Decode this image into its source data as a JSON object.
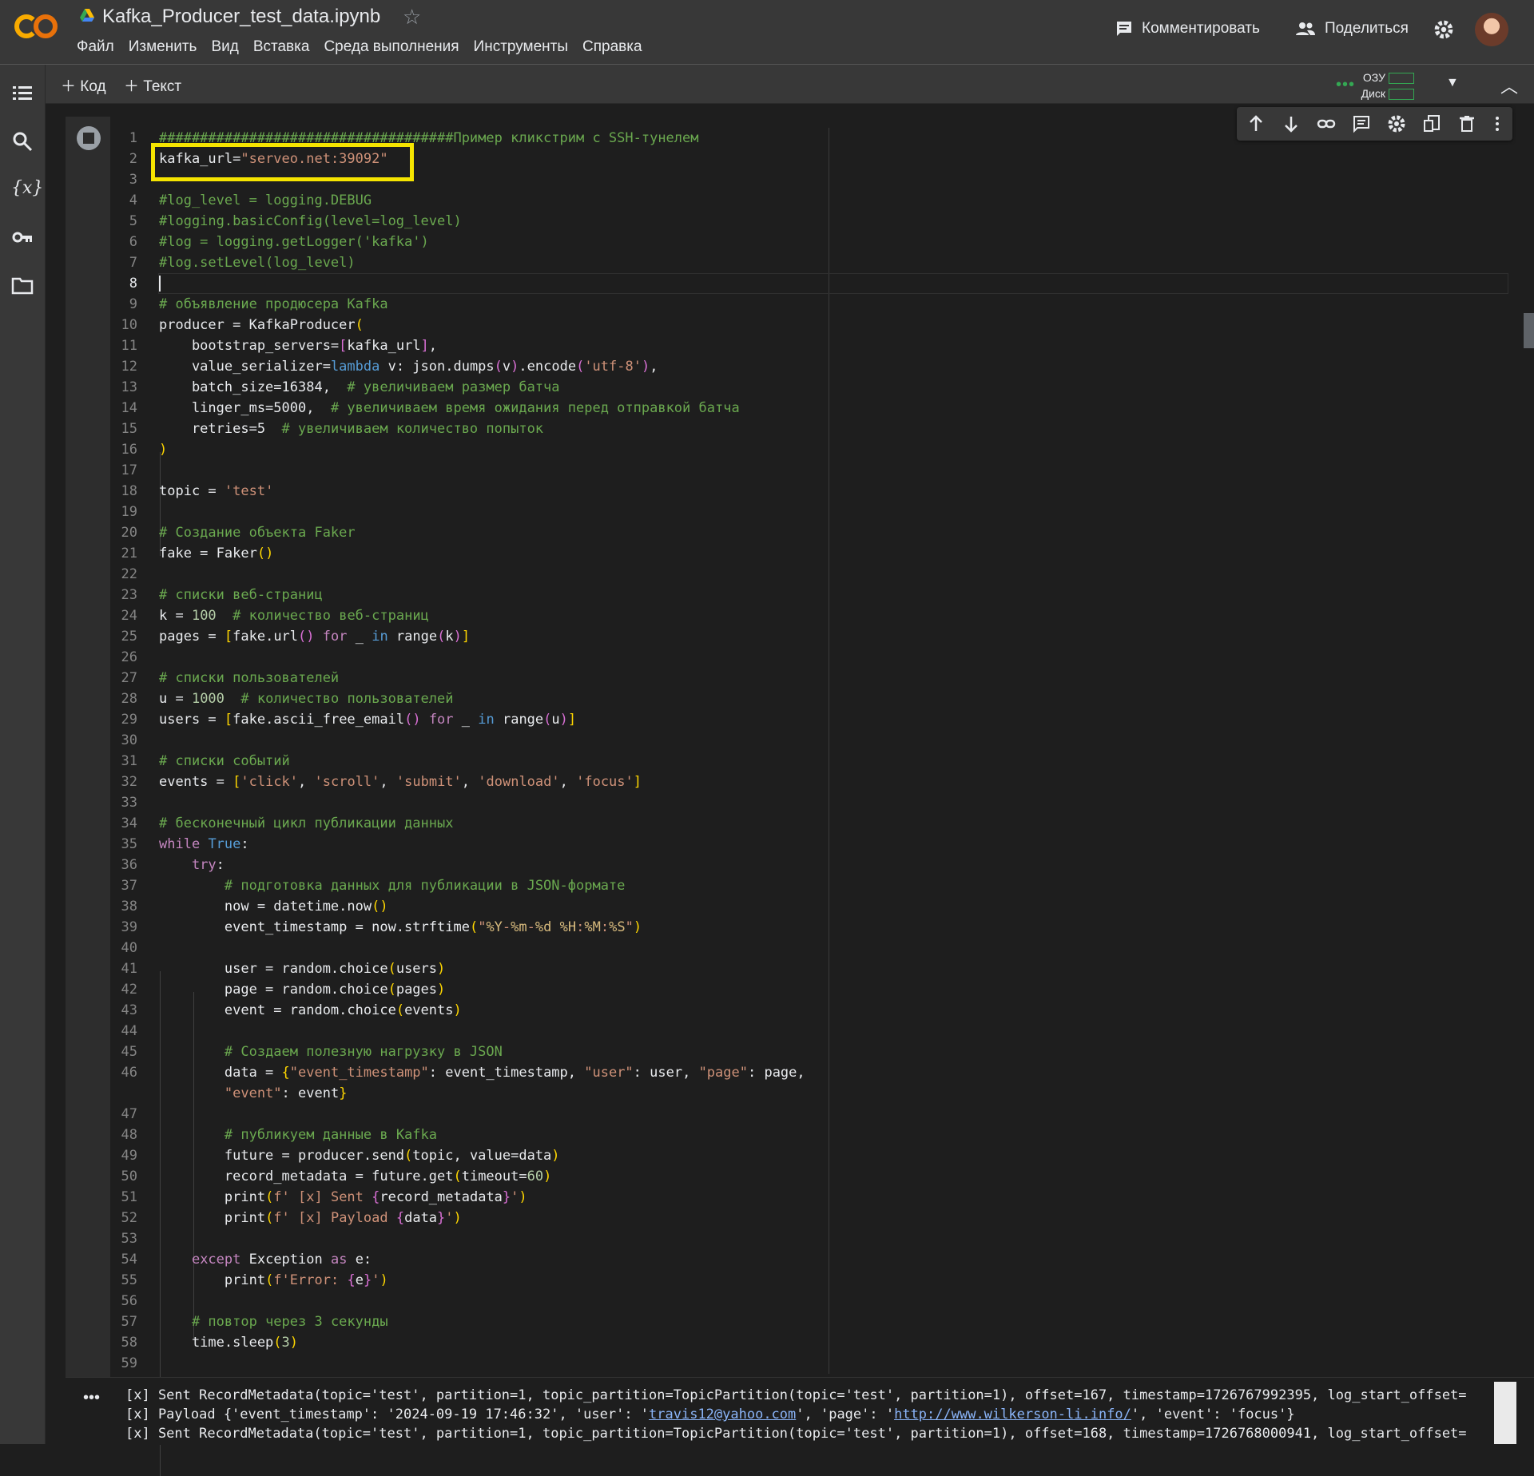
{
  "app": {
    "title": "Kafka_Producer_test_data.ipynb",
    "menu": [
      "Файл",
      "Изменить",
      "Вид",
      "Вставка",
      "Среда выполнения",
      "Инструменты",
      "Справка"
    ],
    "comment_label": "Комментировать",
    "share_label": "Поделиться"
  },
  "toolbar": {
    "code_label": "Код",
    "text_label": "Текст",
    "ram_label": "ОЗУ",
    "disk_label": "Диск"
  },
  "sidebar": {
    "icons": [
      "table-of-contents-icon",
      "search-icon",
      "variables-icon",
      "secrets-key-icon",
      "folder-icon"
    ]
  },
  "code_lines": [
    "####################################Пример кликстрим с SSH-тунелем",
    "kafka_url=\"serveo.net:39092\"",
    "",
    "#log_level = logging.DEBUG",
    "#logging.basicConfig(level=log_level)",
    "#log = logging.getLogger('kafka')",
    "#log.setLevel(log_level)",
    "",
    "# объявление продюсера Kafka",
    "producer = KafkaProducer(",
    "    bootstrap_servers=[kafka_url],",
    "    value_serializer=lambda v: json.dumps(v).encode('utf-8'),",
    "    batch_size=16384,  # увеличиваем размер батча",
    "    linger_ms=5000,  # увеличиваем время ожидания перед отправкой батча",
    "    retries=5  # увеличиваем количество попыток",
    ")",
    "",
    "topic = 'test'",
    "",
    "# Создание объекта Faker",
    "fake = Faker()",
    "",
    "# списки веб-страниц",
    "k = 100  # количество веб-страниц",
    "pages = [fake.url() for _ in range(k)]",
    "",
    "# списки пользователей",
    "u = 1000  # количество пользователей",
    "users = [fake.ascii_free_email() for _ in range(u)]",
    "",
    "# списки событий",
    "events = ['click', 'scroll', 'submit', 'download', 'focus']",
    "",
    "# бесконечный цикл публикации данных",
    "while True:",
    "    try:",
    "        # подготовка данных для публикации в JSON-формате",
    "        now = datetime.now()",
    "        event_timestamp = now.strftime(\"%Y-%m-%d %H:%M:%S\")",
    "",
    "        user = random.choice(users)",
    "        page = random.choice(pages)",
    "        event = random.choice(events)",
    "",
    "        # Создаем полезную нагрузку в JSON",
    "        data = {\"event_timestamp\": event_timestamp, \"user\": user, \"page\": page,",
    "        \"event\": event}",
    "",
    "        # публикуем данные в Kafka",
    "        future = producer.send(topic, value=data)",
    "        record_metadata = future.get(timeout=60)",
    "        print(f' [x] Sent {record_metadata}')",
    "        print(f' [x] Payload {data}')",
    "",
    "    except Exception as e:",
    "        print(f'Error: {e}')",
    "",
    "    # повтор через 3 секунды",
    "    time.sleep(3)",
    ""
  ],
  "output_lines": [
    "[x] Sent RecordMetadata(topic='test', partition=1, topic_partition=TopicPartition(topic='test', partition=1), offset=167, timestamp=1726767992395, log_start_offset=",
    "[x] Payload {'event_timestamp': '2024-09-19 17:46:32', 'user': 'travis12@yahoo.com', 'page': 'http://www.wilkerson-li.info/', 'event': 'focus'}",
    "[x] Sent RecordMetadata(topic='test', partition=1, topic_partition=TopicPartition(topic='test', partition=1), offset=168, timestamp=1726768000941, log_start_offset="
  ],
  "output_parts": {
    "payload_prefix": "[x] Payload {'event_timestamp': '2024-09-19 17:46:32', 'user': '",
    "payload_email": "travis12@yahoo.com",
    "payload_mid": "', 'page': '",
    "payload_url": "http://www.wilkerson-li.info/",
    "payload_suffix": "', 'event': 'focus'}"
  }
}
